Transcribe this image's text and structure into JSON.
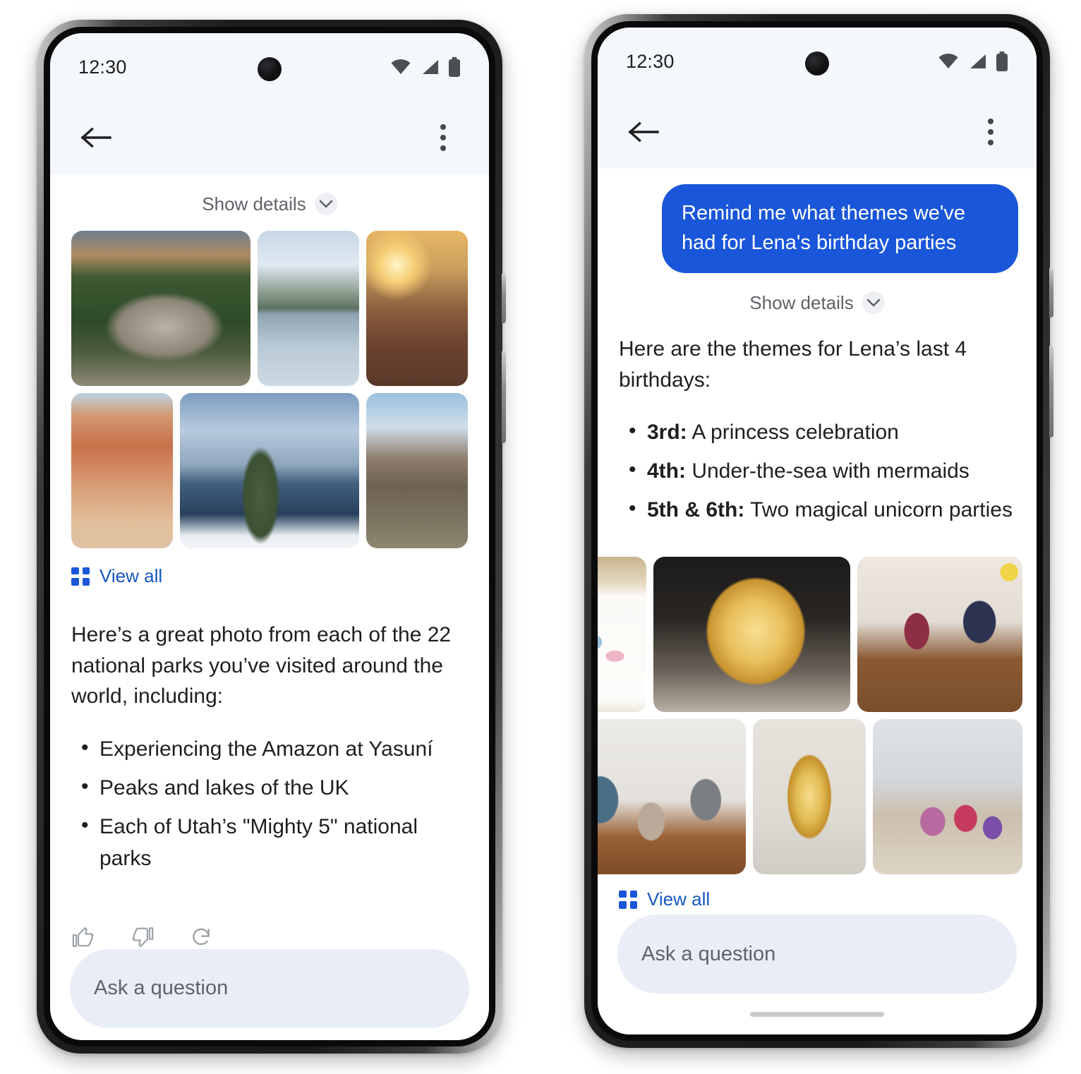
{
  "screens": [
    {
      "id": "national-parks",
      "status_bar": {
        "time": "12:30",
        "icons": [
          "wifi-icon",
          "cellular-signal-icon",
          "battery-icon"
        ]
      },
      "app_bar": {
        "back": "back-arrow-icon",
        "overflow": "more-options-icon"
      },
      "show_details": {
        "label": "Show details",
        "chevron": "chevron-down-icon"
      },
      "photos": {
        "row1": [
          "amazon-canopy-selfie",
          "uk-lake-and-peaks",
          "sunrise-rocky-ridge"
        ],
        "row2": [
          "bryce-canyon-hoodoos",
          "crater-lake-portrait",
          "zion-canyon-view"
        ]
      },
      "view_all": {
        "label": "View all",
        "icon": "grid-view-icon"
      },
      "answer": {
        "paragraph": "Here’s a great photo from each of the 22 national parks you’ve visited around the world, including:",
        "bullets": [
          {
            "bold": "",
            "text": "Experiencing the Amazon at Yasuní"
          },
          {
            "bold": "",
            "text": "Peaks and lakes of the UK"
          },
          {
            "bold": "",
            "text": "Each of Utah’s \"Mighty 5\" national parks"
          }
        ]
      },
      "feedback": [
        "thumb-up-icon",
        "thumb-down-icon",
        "regenerate-icon"
      ],
      "composer": {
        "placeholder": "Ask a question"
      }
    },
    {
      "id": "birthday-themes",
      "status_bar": {
        "time": "12:30",
        "icons": [
          "wifi-icon",
          "cellular-signal-icon",
          "battery-icon"
        ]
      },
      "app_bar": {
        "back": "back-arrow-icon",
        "overflow": "more-options-icon"
      },
      "user_message": "Remind me what themes we've had for Lena's birthday parties",
      "show_details": {
        "label": "Show details",
        "chevron": "chevron-down-icon"
      },
      "answer": {
        "paragraph": "Here are the themes for Lena’s last 4 birthdays:",
        "bullets": [
          {
            "bold": "3rd:",
            "text": " A princess celebration"
          },
          {
            "bold": "4th:",
            "text": " Under-the-sea with mermaids"
          },
          {
            "bold": "5th & 6th:",
            "text": " Two magical unicorn parties"
          }
        ]
      },
      "photos": {
        "row1": [
          "under-the-sea-invitation",
          "gold-four-balloon-girl",
          "girl-and-dad-with-cake"
        ],
        "row2": [
          "family-portrait-at-table",
          "gold-six-balloon",
          "gift-table-at-party"
        ]
      },
      "view_all": {
        "label": "View all",
        "icon": "grid-view-icon"
      },
      "composer": {
        "placeholder": "Ask a question"
      }
    }
  ],
  "colors": {
    "accent_blue": "#1a56d9",
    "link_blue": "#1558c0",
    "status_bar_bg": "#f4f7fc",
    "composer_bg": "#e9edf6",
    "text_primary": "#1f1f1f",
    "text_secondary": "#5f6368"
  }
}
